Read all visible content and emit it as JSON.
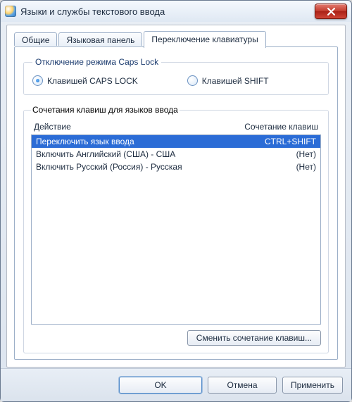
{
  "window": {
    "title": "Языки и службы текстового ввода"
  },
  "tabs": [
    {
      "label": "Общие",
      "active": false
    },
    {
      "label": "Языковая панель",
      "active": false
    },
    {
      "label": "Переключение клавиатуры",
      "active": true
    }
  ],
  "capslock_group": {
    "legend": "Отключение режима Caps Lock",
    "options": [
      {
        "label": "Клавишей CAPS LOCK",
        "checked": true
      },
      {
        "label": "Клавишей SHIFT",
        "checked": false
      }
    ]
  },
  "hotkeys_group": {
    "legend": "Сочетания клавиш для языков ввода",
    "columns": {
      "action": "Действие",
      "shortcut": "Сочетание клавиш"
    },
    "rows": [
      {
        "action": "Переключить язык ввода",
        "shortcut": "CTRL+SHIFT",
        "selected": true
      },
      {
        "action": "Включить Английский (США) - США",
        "shortcut": "(Нет)",
        "selected": false
      },
      {
        "action": "Включить Русский (Россия) - Русская",
        "shortcut": "(Нет)",
        "selected": false
      }
    ],
    "change_button": "Сменить сочетание клавиш..."
  },
  "footer": {
    "ok": "OK",
    "cancel": "Отмена",
    "apply": "Применить"
  }
}
